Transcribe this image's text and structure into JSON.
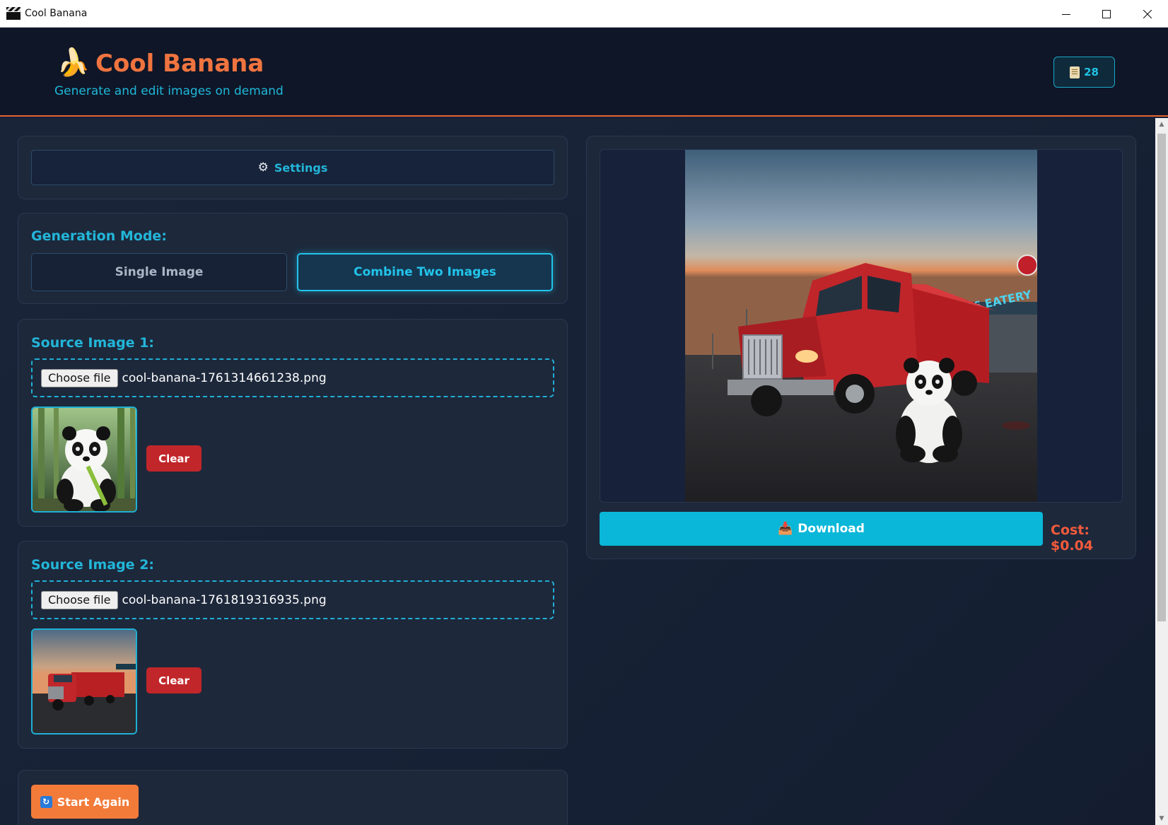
{
  "window": {
    "title": "Cool Banana"
  },
  "header": {
    "app_title": "Cool Banana",
    "subtitle": "Generate and edit images on demand",
    "counter": "28"
  },
  "settings": {
    "label": "Settings"
  },
  "mode": {
    "label": "Generation Mode:",
    "options": [
      "Single Image",
      "Combine Two Images"
    ],
    "selected": "Combine Two Images"
  },
  "source1": {
    "label": "Source Image 1:",
    "choose_label": "Choose file",
    "file_name": "cool-banana-1761314661238.png",
    "clear_label": "Clear"
  },
  "source2": {
    "label": "Source Image 2:",
    "choose_label": "Choose file",
    "file_name": "cool-banana-1761819316935.png",
    "clear_label": "Clear"
  },
  "actions": {
    "start_again_label": "Start Again"
  },
  "result": {
    "download_label": "Download",
    "cost": "Cost: $0.04",
    "sign_text": "66 EATERY"
  },
  "colors": {
    "accent_orange": "#f0743f",
    "accent_cyan": "#22b6d9",
    "danger": "#c1262a",
    "download": "#0ab7d8",
    "background": "#16203a"
  }
}
